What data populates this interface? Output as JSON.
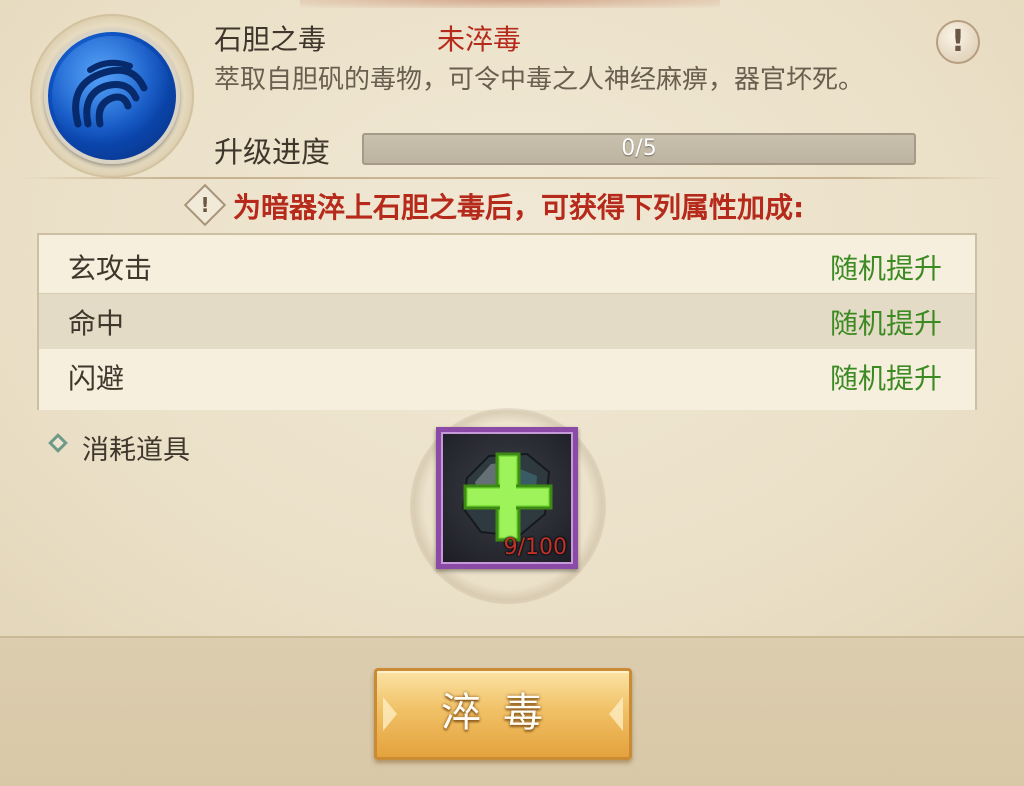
{
  "poison": {
    "name": "石胆之毒",
    "status": "未淬毒",
    "description": "萃取自胆矾的毒物，可令中毒之人神经麻痹，器官坏死。",
    "progress_label": "升级进度",
    "progress_text": "0/5",
    "progress_fraction": 0
  },
  "notice": {
    "text": "为暗器淬上石胆之毒后，可获得下列属性加成:"
  },
  "attributes": [
    {
      "name": "玄攻击",
      "value": "随机提升"
    },
    {
      "name": "命中",
      "value": "随机提升"
    },
    {
      "name": "闪避",
      "value": "随机提升"
    }
  ],
  "consume": {
    "label": "消耗道具",
    "item_count": "9/100"
  },
  "action": {
    "label": "淬毒"
  },
  "icons": {
    "info": "exclamation-icon",
    "skill": "blue-whirl-orb-icon",
    "item": "ore-with-plus-icon"
  },
  "colors": {
    "status_red": "#b62a1c",
    "value_green": "#3c8a22",
    "slot_purple": "#8a4aa6"
  }
}
